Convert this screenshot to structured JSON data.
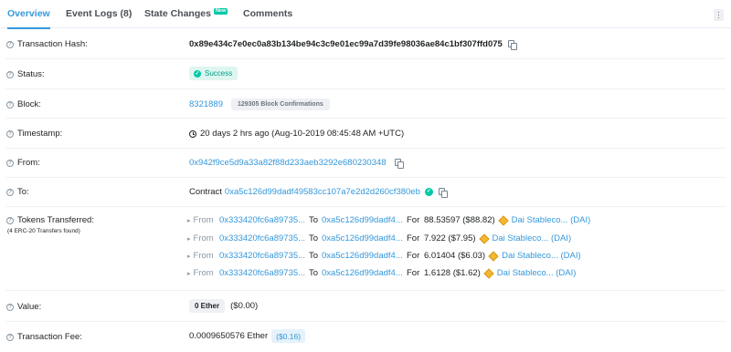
{
  "tabs": [
    {
      "label": "Overview"
    },
    {
      "label": "Event Logs (8)"
    },
    {
      "label": "State Changes",
      "badge": "New"
    },
    {
      "label": "Comments"
    }
  ],
  "fields": {
    "tx_hash": {
      "label": "Transaction Hash:",
      "value": "0x89e434c7e0ec0a83b134be94c3c9e01ec99a7d39fe98036ae84c1bf307ffd075"
    },
    "status": {
      "label": "Status:",
      "value": "Success"
    },
    "block": {
      "label": "Block:",
      "value": "8321889",
      "confirmations": "129305 Block Confirmations"
    },
    "timestamp": {
      "label": "Timestamp:",
      "value": "20 days 2 hrs ago (Aug-10-2019 08:45:48 AM +UTC)"
    },
    "from": {
      "label": "From:",
      "value": "0x942f9ce5d9a33a82f88d233aeb3292e680230348"
    },
    "to": {
      "label": "To:",
      "prefix": "Contract",
      "value": "0xa5c126d99dadf49583cc107a7e2d2d260cf380eb"
    },
    "tokens": {
      "label": "Tokens Transferred:",
      "sublabel": "(4 ERC-20 Transfers found)",
      "rows": [
        {
          "from_word": "From",
          "from": "0x333420fc6a89735...",
          "to_word": "To",
          "to": "0xa5c126d99dadf4...",
          "for_word": "For",
          "amount": "88.53597 ($88.82)",
          "token": "Dai Stableco... (DAI)"
        },
        {
          "from_word": "From",
          "from": "0x333420fc6a89735...",
          "to_word": "To",
          "to": "0xa5c126d99dadf4...",
          "for_word": "For",
          "amount": "7.922 ($7.95)",
          "token": "Dai Stableco... (DAI)"
        },
        {
          "from_word": "From",
          "from": "0x333420fc6a89735...",
          "to_word": "To",
          "to": "0xa5c126d99dadf4...",
          "for_word": "For",
          "amount": "6.01404 ($6.03)",
          "token": "Dai Stableco... (DAI)"
        },
        {
          "from_word": "From",
          "from": "0x333420fc6a89735...",
          "to_word": "To",
          "to": "0xa5c126d99dadf4...",
          "for_word": "For",
          "amount": "1.6128 ($1.62)",
          "token": "Dai Stableco... (DAI)"
        }
      ]
    },
    "value": {
      "label": "Value:",
      "ether": "0 Ether",
      "usd": "($0.00)"
    },
    "fee": {
      "label": "Transaction Fee:",
      "value": "0.0009650576 Ether",
      "usd": "($0.16)"
    }
  },
  "colors": {
    "link": "#3498db",
    "success": "#00c9a7",
    "token": "#f4b731"
  }
}
